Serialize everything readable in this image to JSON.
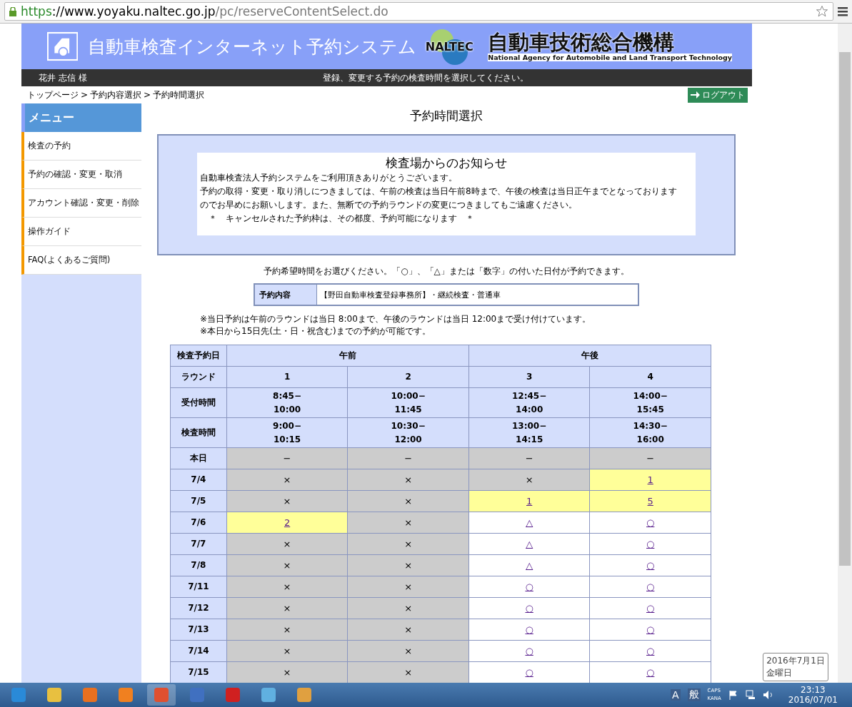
{
  "browser": {
    "url_scheme": "https",
    "url_host": "://www.yoyaku.naltec.go.jp",
    "url_path": "/pc/reserveContentSelect.do"
  },
  "header": {
    "system_title": "自動車検査インターネット予約システム",
    "org_logo": "NALTEC",
    "org_name": "自動車技術総合機構",
    "org_name_en": "National Agency for Automobile and Land Transport Technology"
  },
  "user_bar": {
    "user": "花井 志信 様",
    "message": "登録、変更する予約の検査時間を選択してください。"
  },
  "breadcrumb": [
    "トップページ",
    "予約内容選択",
    "予約時間選択"
  ],
  "breadcrumb_separator": ">",
  "logout": "ログアウト",
  "sidebar": {
    "title": "メニュー",
    "items": [
      "検査の予約",
      "予約の確認・変更・取消",
      "アカウント確認・変更・削除",
      "操作ガイド",
      "FAQ(よくあるご質問)"
    ]
  },
  "page_title": "予約時間選択",
  "notice": {
    "title": "検査場からのお知らせ",
    "lines": [
      "自動車検査法人予約システムをご利用頂きありがとうございます。",
      "予約の取得・変更・取り消しにつきましては、午前の検査は当日午前8時まで、午後の検査は当日正午までとなっております",
      "のでお早めにお願いします。また、無断での予約ラウンドの変更につきましてもご遠慮ください。",
      "　＊　キャンセルされた予約枠は、その都度、予約可能になります　＊"
    ]
  },
  "instruction": "予約希望時間をお選びください。「○」、「△」または「数字」の付いた日付が予約できます。",
  "reservation": {
    "label": "予約内容",
    "value": "【野田自動車検査登録事務所】・継続検査・普通車"
  },
  "notes": [
    "※当日予約は午前のラウンドは当日 8:00まで、午後のラウンドは当日 12:00まで受け付けています。",
    "※本日から15日先(土・日・祝含む)までの予約が可能です。"
  ],
  "table": {
    "date_header": "検査予約日",
    "periods": [
      "午前",
      "午後"
    ],
    "round_label": "ラウンド",
    "rounds": [
      "1",
      "2",
      "3",
      "4"
    ],
    "reception_label": "受付時間",
    "reception": [
      [
        "8:45−",
        "10:00"
      ],
      [
        "10:00−",
        "11:45"
      ],
      [
        "12:45−",
        "14:00"
      ],
      [
        "14:00−",
        "15:45"
      ]
    ],
    "inspection_label": "検査時間",
    "inspection": [
      [
        "9:00−",
        "10:15"
      ],
      [
        "10:30−",
        "12:00"
      ],
      [
        "13:00−",
        "14:15"
      ],
      [
        "14:30−",
        "16:00"
      ]
    ],
    "rows": [
      {
        "date": "本日",
        "cells": [
          {
            "kind": "none",
            "text": "−"
          },
          {
            "kind": "none",
            "text": "−"
          },
          {
            "kind": "none",
            "text": "−"
          },
          {
            "kind": "none",
            "text": "−"
          }
        ]
      },
      {
        "date": "7/4",
        "cells": [
          {
            "kind": "full",
            "text": "×"
          },
          {
            "kind": "full",
            "text": "×"
          },
          {
            "kind": "full",
            "text": "×"
          },
          {
            "kind": "few",
            "text": "1"
          }
        ]
      },
      {
        "date": "7/5",
        "cells": [
          {
            "kind": "full",
            "text": "×"
          },
          {
            "kind": "full",
            "text": "×"
          },
          {
            "kind": "few",
            "text": "1"
          },
          {
            "kind": "few",
            "text": "5"
          }
        ]
      },
      {
        "date": "7/6",
        "cells": [
          {
            "kind": "few",
            "text": "2"
          },
          {
            "kind": "full",
            "text": "×"
          },
          {
            "kind": "open",
            "text": "△"
          },
          {
            "kind": "open",
            "text": "○"
          }
        ]
      },
      {
        "date": "7/7",
        "cells": [
          {
            "kind": "full",
            "text": "×"
          },
          {
            "kind": "full",
            "text": "×"
          },
          {
            "kind": "open",
            "text": "△"
          },
          {
            "kind": "open",
            "text": "○"
          }
        ]
      },
      {
        "date": "7/8",
        "cells": [
          {
            "kind": "full",
            "text": "×"
          },
          {
            "kind": "full",
            "text": "×"
          },
          {
            "kind": "open",
            "text": "△"
          },
          {
            "kind": "open",
            "text": "○"
          }
        ]
      },
      {
        "date": "7/11",
        "cells": [
          {
            "kind": "full",
            "text": "×"
          },
          {
            "kind": "full",
            "text": "×"
          },
          {
            "kind": "open",
            "text": "○"
          },
          {
            "kind": "open",
            "text": "○"
          }
        ]
      },
      {
        "date": "7/12",
        "cells": [
          {
            "kind": "full",
            "text": "×"
          },
          {
            "kind": "full",
            "text": "×"
          },
          {
            "kind": "open",
            "text": "○"
          },
          {
            "kind": "open",
            "text": "○"
          }
        ]
      },
      {
        "date": "7/13",
        "cells": [
          {
            "kind": "full",
            "text": "×"
          },
          {
            "kind": "full",
            "text": "×"
          },
          {
            "kind": "open",
            "text": "○"
          },
          {
            "kind": "open",
            "text": "○"
          }
        ]
      },
      {
        "date": "7/14",
        "cells": [
          {
            "kind": "full",
            "text": "×"
          },
          {
            "kind": "full",
            "text": "×"
          },
          {
            "kind": "open",
            "text": "○"
          },
          {
            "kind": "open",
            "text": "○"
          }
        ]
      },
      {
        "date": "7/15",
        "cells": [
          {
            "kind": "full",
            "text": "×"
          },
          {
            "kind": "full",
            "text": "×"
          },
          {
            "kind": "open",
            "text": "○"
          },
          {
            "kind": "open",
            "text": "○"
          }
        ]
      }
    ]
  },
  "tooltip": [
    "2016年7月1日",
    "金曜日"
  ],
  "taskbar": {
    "ime": [
      "A",
      "般"
    ],
    "caps": "CAPS",
    "kana": "KANA",
    "time": "23:13",
    "date": "2016/07/01"
  }
}
